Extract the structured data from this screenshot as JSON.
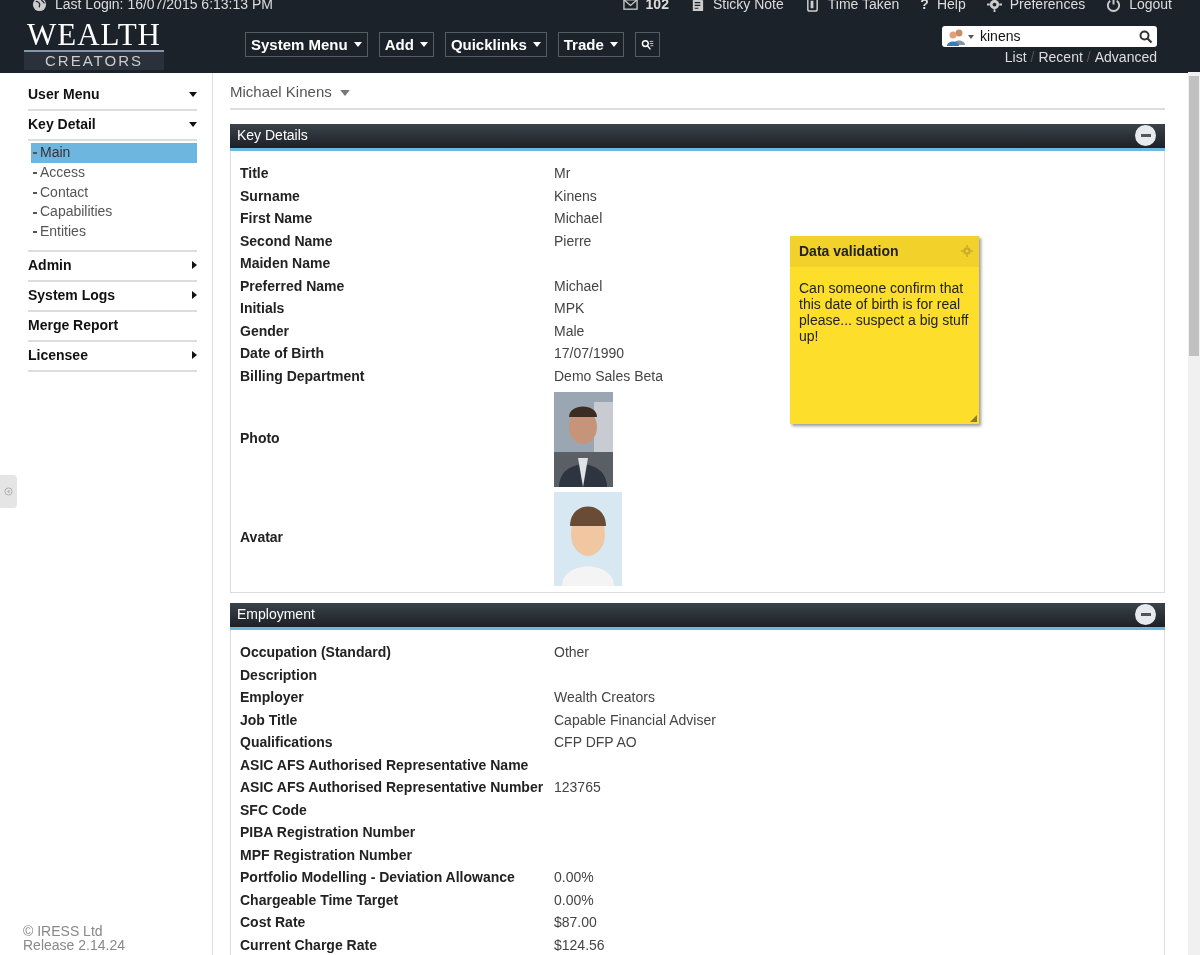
{
  "top_bar": {
    "last_login": "Last Login: 16/07/2015 6:13:13 PM",
    "links": [
      {
        "kind": "mail",
        "label": "102",
        "bold": true
      },
      {
        "kind": "note",
        "label": "Sticky Note",
        "bold": false
      },
      {
        "kind": "timer",
        "label": "Time Taken",
        "bold": false
      },
      {
        "kind": "help",
        "glyph": "?",
        "label": "Help",
        "bold": false
      },
      {
        "kind": "gear",
        "label": "Preferences",
        "bold": false
      },
      {
        "kind": "power",
        "label": "Logout",
        "bold": false
      }
    ]
  },
  "logo": {
    "line_1": "WEALTH",
    "line_2": "CREATORS"
  },
  "menus": [
    "System Menu",
    "Add",
    "Quicklinks",
    "Trade"
  ],
  "search": {
    "value": "kinens",
    "links": [
      "List",
      "Recent",
      "Advanced"
    ],
    "separator": "/"
  },
  "sidebar": {
    "items": [
      {
        "label": "User Menu",
        "expanded": true
      },
      {
        "label": "Key Detail",
        "expanded": true,
        "children": [
          {
            "label": "Main",
            "selected": true
          },
          {
            "label": "Access",
            "selected": false
          },
          {
            "label": "Contact",
            "selected": false
          },
          {
            "label": "Capabilities",
            "selected": false
          },
          {
            "label": "Entities",
            "selected": false
          }
        ]
      },
      {
        "label": "Admin",
        "expanded": false
      },
      {
        "label": "System Logs",
        "expanded": false
      },
      {
        "label": "Merge Report"
      },
      {
        "label": "Licensee",
        "expanded": false
      }
    ],
    "footer": [
      "© IRESS Ltd",
      "Release 2.14.24"
    ]
  },
  "breadcrumb": "Michael Kinens",
  "sections": [
    {
      "title": "Key Details",
      "fields": [
        {
          "kind": "text",
          "label": "Title",
          "value": "Mr"
        },
        {
          "kind": "text",
          "label": "Surname",
          "value": "Kinens"
        },
        {
          "kind": "text",
          "label": "First Name",
          "value": "Michael"
        },
        {
          "kind": "text",
          "label": "Second Name",
          "value": "Pierre"
        },
        {
          "kind": "text",
          "label": "Maiden Name"
        },
        {
          "kind": "text",
          "label": "Preferred Name",
          "value": "Michael"
        },
        {
          "kind": "text",
          "label": "Initials",
          "value": "MPK"
        },
        {
          "kind": "text",
          "label": "Gender",
          "value": "Male"
        },
        {
          "kind": "text",
          "label": "Date of Birth",
          "value": "17/07/1990"
        },
        {
          "kind": "text",
          "label": "Billing Department",
          "value": "Demo Sales Beta"
        },
        {
          "label": "Photo"
        },
        {
          "kind": "avatar",
          "label": "Avatar"
        }
      ]
    },
    {
      "title": "Employment",
      "fields": [
        {
          "kind": "text",
          "label": "Occupation (Standard)",
          "value": "Other"
        },
        {
          "kind": "text",
          "label": "Description"
        },
        {
          "kind": "text",
          "label": "Employer",
          "value": "Wealth Creators"
        },
        {
          "kind": "text",
          "label": "Job Title",
          "value": "Capable Financial Adviser"
        },
        {
          "kind": "text",
          "label": "Qualifications",
          "value": "CFP DFP AO"
        },
        {
          "kind": "text",
          "label": "ASIC AFS Authorised Representative Name"
        },
        {
          "kind": "text",
          "label": "ASIC AFS Authorised Representative Number",
          "value": "123765"
        },
        {
          "kind": "text",
          "label": "SFC Code"
        },
        {
          "kind": "text",
          "label": "PIBA Registration Number"
        },
        {
          "kind": "text",
          "label": "MPF Registration Number"
        },
        {
          "kind": "text",
          "label": "Portfolio Modelling - Deviation Allowance",
          "value": "0.00%"
        },
        {
          "kind": "text",
          "label": "Chargeable Time Target",
          "value": "0.00%"
        },
        {
          "kind": "text",
          "label": "Cost Rate",
          "value": "$87.00"
        },
        {
          "kind": "text",
          "label": "Current Charge Rate",
          "value": "$124.56"
        }
      ]
    }
  ],
  "sticky_note": {
    "title": "Data validation",
    "body": "Can someone confirm that this date of birth is for real please... suspect a big stuff up!"
  }
}
